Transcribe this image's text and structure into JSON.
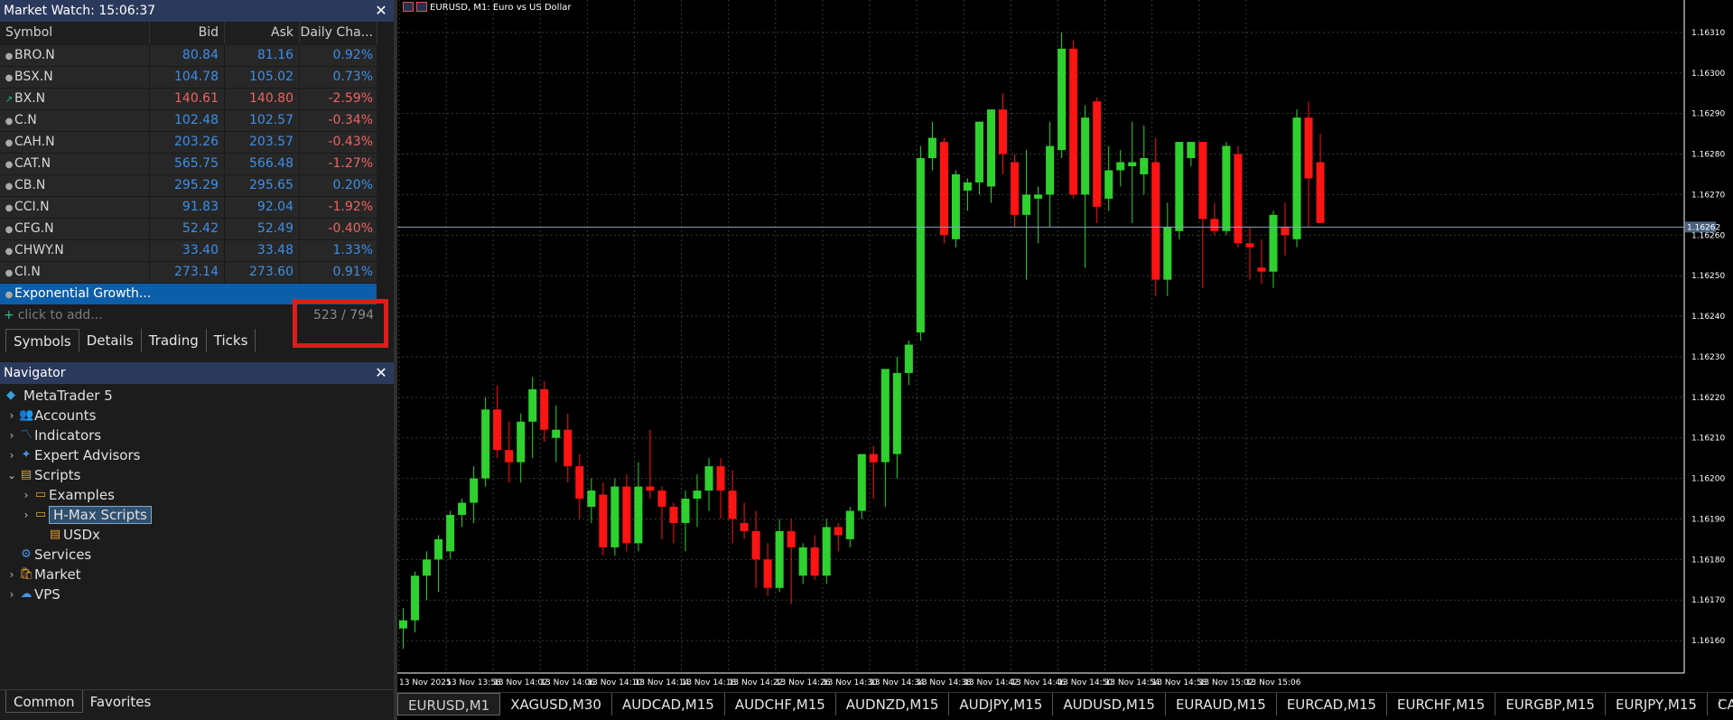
{
  "market_watch": {
    "title": "Market Watch: 15:06:37",
    "columns": [
      "Symbol",
      "Bid",
      "Ask",
      "Daily Cha..."
    ],
    "rows": [
      {
        "symbol": "BRO.N",
        "bid": "80.84",
        "ask": "81.16",
        "change": "0.92%",
        "dir": "up",
        "icon": "dot"
      },
      {
        "symbol": "BSX.N",
        "bid": "104.78",
        "ask": "105.02",
        "change": "0.73%",
        "dir": "up",
        "icon": "dot"
      },
      {
        "symbol": "BX.N",
        "bid": "140.61",
        "ask": "140.80",
        "change": "-2.59%",
        "dir": "down",
        "icon": "arrow-up"
      },
      {
        "symbol": "C.N",
        "bid": "102.48",
        "ask": "102.57",
        "change": "-0.34%",
        "dir": "up",
        "icon": "dot"
      },
      {
        "symbol": "CAH.N",
        "bid": "203.26",
        "ask": "203.57",
        "change": "-0.43%",
        "dir": "up",
        "icon": "dot"
      },
      {
        "symbol": "CAT.N",
        "bid": "565.75",
        "ask": "566.48",
        "change": "-1.27%",
        "dir": "up",
        "icon": "dot"
      },
      {
        "symbol": "CB.N",
        "bid": "295.29",
        "ask": "295.65",
        "change": "0.20%",
        "dir": "up",
        "icon": "dot"
      },
      {
        "symbol": "CCI.N",
        "bid": "91.83",
        "ask": "92.04",
        "change": "-1.92%",
        "dir": "up",
        "icon": "dot"
      },
      {
        "symbol": "CFG.N",
        "bid": "52.42",
        "ask": "52.49",
        "change": "-0.40%",
        "dir": "up",
        "icon": "dot"
      },
      {
        "symbol": "CHWY.N",
        "bid": "33.40",
        "ask": "33.48",
        "change": "1.33%",
        "dir": "up",
        "icon": "dot"
      },
      {
        "symbol": "CI.N",
        "bid": "273.14",
        "ask": "273.60",
        "change": "0.91%",
        "dir": "up",
        "icon": "dot"
      }
    ],
    "selected_row": "Exponential Growth...",
    "add_placeholder": "click to add...",
    "count": "523 / 794",
    "tabs": [
      "Symbols",
      "Details",
      "Trading",
      "Ticks"
    ],
    "active_tab": "Symbols"
  },
  "navigator": {
    "title": "Navigator",
    "items": [
      {
        "label": "MetaTrader 5",
        "level": 0,
        "arrow": "",
        "icon": "metatrader-icon",
        "glyph": "◆",
        "color": "#3aa0d8"
      },
      {
        "label": "Accounts",
        "level": 1,
        "arrow": "›",
        "icon": "accounts-icon",
        "glyph": "👥",
        "color": "#4a90e2"
      },
      {
        "label": "Indicators",
        "level": 1,
        "arrow": "›",
        "icon": "indicators-icon",
        "glyph": "〽",
        "color": "#4a90e2"
      },
      {
        "label": "Expert Advisors",
        "level": 1,
        "arrow": "›",
        "icon": "expert-advisors-icon",
        "glyph": "✦",
        "color": "#4a90e2"
      },
      {
        "label": "Scripts",
        "level": 1,
        "arrow": "⌄",
        "icon": "scripts-icon",
        "glyph": "▤",
        "color": "#e0a030"
      },
      {
        "label": "Examples",
        "level": 2,
        "arrow": "›",
        "icon": "folder-icon",
        "glyph": "▭",
        "color": "#e0a030"
      },
      {
        "label": "H-Max Scripts",
        "level": 2,
        "arrow": "›",
        "icon": "folder-icon",
        "glyph": "▭",
        "color": "#e0a030",
        "highlight": true
      },
      {
        "label": "USDx",
        "level": 3,
        "arrow": "",
        "icon": "script-file-icon",
        "glyph": "▤",
        "color": "#e0a030"
      },
      {
        "label": "Services",
        "level": 1,
        "arrow": "",
        "icon": "services-icon",
        "glyph": "⚙",
        "color": "#4a90e2"
      },
      {
        "label": "Market",
        "level": 1,
        "arrow": "›",
        "icon": "market-icon",
        "glyph": "🛍",
        "color": "#e0a030"
      },
      {
        "label": "VPS",
        "level": 1,
        "arrow": "›",
        "icon": "vps-icon",
        "glyph": "☁",
        "color": "#4a90e2"
      }
    ],
    "tabs": [
      "Common",
      "Favorites"
    ],
    "active_tab": "Common"
  },
  "chart": {
    "header": "EURUSD, M1:  Euro vs US Dollar",
    "current_price": "1.16262",
    "colors": {
      "bull": "#2fd12f",
      "bear": "#ff1414",
      "grid": "#3a3a3a",
      "axis": "#ffffff",
      "price_line": "#8aa4c0"
    }
  },
  "chart_data": {
    "type": "candlestick",
    "symbol": "EURUSD",
    "timeframe": "M1",
    "y_ticks": [
      "1.16310",
      "1.16300",
      "1.16290",
      "1.16280",
      "1.16270",
      "1.16260",
      "1.16250",
      "1.16240",
      "1.16230",
      "1.16220",
      "1.16210",
      "1.16200",
      "1.16190",
      "1.16180",
      "1.16170",
      "1.16160"
    ],
    "ylim": [
      1.16152,
      1.16318
    ],
    "x_ticks": [
      "13 Nov 2025",
      "13 Nov 13:58",
      "13 Nov 14:02",
      "13 Nov 14:06",
      "13 Nov 14:10",
      "13 Nov 14:14",
      "13 Nov 14:18",
      "13 Nov 14:22",
      "13 Nov 14:26",
      "13 Nov 14:30",
      "13 Nov 14:34",
      "13 Nov 14:38",
      "13 Nov 14:42",
      "13 Nov 14:46",
      "13 Nov 14:50",
      "13 Nov 14:54",
      "13 Nov 14:58",
      "13 Nov 15:02",
      "13 Nov 15:06"
    ],
    "current_price": 1.16262,
    "candles": [
      [
        1.16163,
        1.16168,
        1.16158,
        1.16165
      ],
      [
        1.16165,
        1.16177,
        1.16162,
        1.16176
      ],
      [
        1.16176,
        1.16182,
        1.1617,
        1.1618
      ],
      [
        1.1618,
        1.16186,
        1.16172,
        1.16185
      ],
      [
        1.16182,
        1.16192,
        1.1618,
        1.16191
      ],
      [
        1.16191,
        1.16195,
        1.16188,
        1.16194
      ],
      [
        1.16194,
        1.16203,
        1.16189,
        1.162
      ],
      [
        1.162,
        1.1622,
        1.16198,
        1.16217
      ],
      [
        1.16217,
        1.16223,
        1.16205,
        1.16207
      ],
      [
        1.16207,
        1.16214,
        1.16199,
        1.16204
      ],
      [
        1.16204,
        1.16216,
        1.16199,
        1.16214
      ],
      [
        1.16214,
        1.16225,
        1.16205,
        1.16222
      ],
      [
        1.16222,
        1.16224,
        1.16209,
        1.16212
      ],
      [
        1.1621,
        1.16218,
        1.16204,
        1.16212
      ],
      [
        1.16212,
        1.16216,
        1.16199,
        1.16203
      ],
      [
        1.16203,
        1.16206,
        1.1619,
        1.16195
      ],
      [
        1.16193,
        1.162,
        1.16189,
        1.16197
      ],
      [
        1.16196,
        1.16199,
        1.16181,
        1.16183
      ],
      [
        1.16183,
        1.162,
        1.16181,
        1.16198
      ],
      [
        1.16198,
        1.16201,
        1.16182,
        1.16184
      ],
      [
        1.16184,
        1.16204,
        1.16182,
        1.16198
      ],
      [
        1.16198,
        1.16212,
        1.16195,
        1.16197
      ],
      [
        1.16197,
        1.16198,
        1.16185,
        1.16193
      ],
      [
        1.16193,
        1.16194,
        1.16184,
        1.16189
      ],
      [
        1.16189,
        1.16197,
        1.16182,
        1.16195
      ],
      [
        1.16195,
        1.16201,
        1.16188,
        1.16197
      ],
      [
        1.16197,
        1.16205,
        1.16192,
        1.16203
      ],
      [
        1.16203,
        1.16205,
        1.1619,
        1.16197
      ],
      [
        1.16197,
        1.16202,
        1.16184,
        1.1619
      ],
      [
        1.16189,
        1.16194,
        1.16185,
        1.16187
      ],
      [
        1.16187,
        1.16192,
        1.16173,
        1.1618
      ],
      [
        1.1618,
        1.16184,
        1.16171,
        1.16173
      ],
      [
        1.16173,
        1.1619,
        1.16172,
        1.16187
      ],
      [
        1.16187,
        1.1619,
        1.16169,
        1.16183
      ],
      [
        1.16176,
        1.16184,
        1.16174,
        1.16183
      ],
      [
        1.16183,
        1.16186,
        1.16175,
        1.16176
      ],
      [
        1.16176,
        1.1619,
        1.16174,
        1.16188
      ],
      [
        1.16188,
        1.16189,
        1.16182,
        1.16186
      ],
      [
        1.16185,
        1.16193,
        1.16183,
        1.16192
      ],
      [
        1.16192,
        1.16204,
        1.1619,
        1.16206
      ],
      [
        1.16206,
        1.16208,
        1.16195,
        1.16204
      ],
      [
        1.16204,
        1.16216,
        1.16193,
        1.16227
      ],
      [
        1.16206,
        1.1623,
        1.162,
        1.16226
      ],
      [
        1.16226,
        1.16234,
        1.16223,
        1.16233
      ],
      [
        1.16236,
        1.16282,
        1.16234,
        1.16279
      ],
      [
        1.16279,
        1.16288,
        1.16276,
        1.16284
      ],
      [
        1.16283,
        1.16284,
        1.16258,
        1.1626
      ],
      [
        1.16259,
        1.16276,
        1.16257,
        1.16275
      ],
      [
        1.16271,
        1.16274,
        1.16266,
        1.16273
      ],
      [
        1.16273,
        1.16285,
        1.1627,
        1.16288
      ],
      [
        1.16272,
        1.1629,
        1.16268,
        1.16291
      ],
      [
        1.16291,
        1.16295,
        1.16275,
        1.1628
      ],
      [
        1.16278,
        1.1628,
        1.16262,
        1.16265
      ],
      [
        1.16265,
        1.16281,
        1.16249,
        1.1627
      ],
      [
        1.16269,
        1.16272,
        1.16258,
        1.1627
      ],
      [
        1.1627,
        1.16288,
        1.16262,
        1.16282
      ],
      [
        1.16281,
        1.1631,
        1.16279,
        1.16306
      ],
      [
        1.16306,
        1.16308,
        1.16269,
        1.1627
      ],
      [
        1.1627,
        1.16292,
        1.16252,
        1.16289
      ],
      [
        1.16293,
        1.16294,
        1.16263,
        1.16267
      ],
      [
        1.16269,
        1.16282,
        1.16266,
        1.16276
      ],
      [
        1.16276,
        1.16281,
        1.16272,
        1.16278
      ],
      [
        1.16277,
        1.16288,
        1.16263,
        1.16278
      ],
      [
        1.16275,
        1.16287,
        1.1627,
        1.16279
      ],
      [
        1.16278,
        1.16284,
        1.16245,
        1.16249
      ],
      [
        1.16249,
        1.16268,
        1.16245,
        1.16262
      ],
      [
        1.16261,
        1.16281,
        1.16259,
        1.16283
      ],
      [
        1.16279,
        1.16282,
        1.16277,
        1.16283
      ],
      [
        1.16283,
        1.1628,
        1.16247,
        1.16264
      ],
      [
        1.16264,
        1.16268,
        1.1626,
        1.16261
      ],
      [
        1.16261,
        1.16283,
        1.1626,
        1.16282
      ],
      [
        1.1628,
        1.16282,
        1.16257,
        1.16258
      ],
      [
        1.16258,
        1.16262,
        1.16249,
        1.16257
      ],
      [
        1.16252,
        1.16259,
        1.16248,
        1.16251
      ],
      [
        1.16251,
        1.16266,
        1.16247,
        1.16265
      ],
      [
        1.16262,
        1.16268,
        1.16255,
        1.1626
      ],
      [
        1.16259,
        1.16291,
        1.16257,
        1.16289
      ],
      [
        1.16289,
        1.16293,
        1.16262,
        1.16274
      ],
      [
        1.16278,
        1.16285,
        1.16264,
        1.16263
      ]
    ]
  },
  "symbol_tabs": [
    "EURUSD,M1",
    "XAGUSD,M30",
    "AUDCAD,M15",
    "AUDCHF,M15",
    "AUDNZD,M15",
    "AUDJPY,M15",
    "AUDUSD,M15",
    "EURAUD,M15",
    "EURCAD,M15",
    "EURCHF,M15",
    "EURGBP,M15",
    "EURJPY,M15",
    "CADCHF,M"
  ],
  "active_symbol_tab": "EURUSD,M1"
}
